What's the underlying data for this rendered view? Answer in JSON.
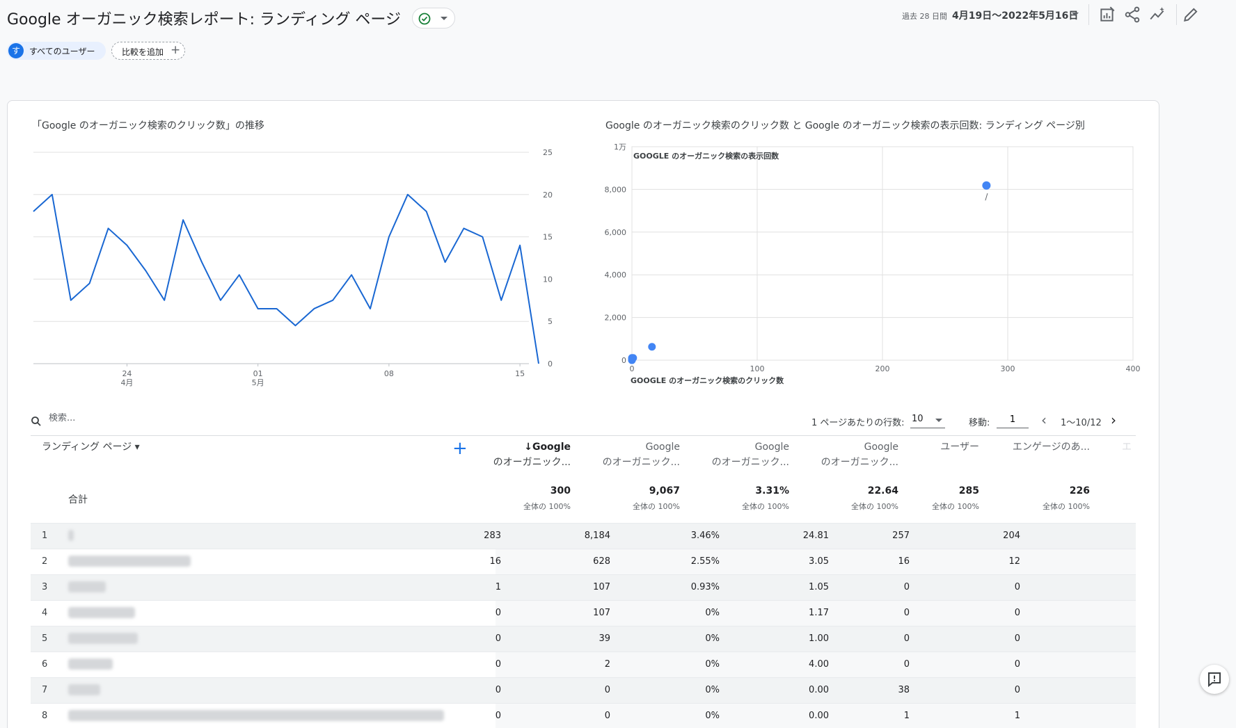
{
  "header": {
    "title": "Google オーガニック検索レポート: ランディング ページ",
    "date_label": "過去 28 日間",
    "date_range": "4月19日〜2022年5月16日"
  },
  "filters": {
    "user_avatar": "す",
    "user_chip": "すべてのユーザー",
    "add_comparison": "比較を追加"
  },
  "line_chart_title": "「Google のオーガニック検索のクリック数」の推移",
  "scatter_chart_title": "Google のオーガニック検索のクリック数 と Google のオーガニック検索の表示回数: ランディング ページ別",
  "chart_data": [
    {
      "type": "line",
      "title": "「Google のオーガニック検索のクリック数」の推移",
      "x": [
        "4/19",
        "4/20",
        "4/21",
        "4/22",
        "4/23",
        "4/24",
        "4/25",
        "4/26",
        "4/27",
        "4/28",
        "4/29",
        "4/30",
        "5/01",
        "5/02",
        "5/03",
        "5/04",
        "5/05",
        "5/06",
        "5/07",
        "5/08",
        "5/09",
        "5/10",
        "5/11",
        "5/12",
        "5/13",
        "5/14",
        "5/15",
        "5/16"
      ],
      "series": [
        {
          "values": [
            18,
            20,
            7.5,
            9.5,
            16,
            14,
            11,
            7.5,
            17,
            12,
            7.5,
            10.5,
            6.5,
            6.5,
            4.5,
            6.5,
            7.5,
            10.5,
            6.5,
            15,
            20,
            18,
            12,
            16,
            15,
            7.5,
            14,
            0
          ],
          "color": "#1967d2"
        }
      ],
      "x_tick_labels": [
        {
          "day": "24",
          "month": "4月",
          "x_index": 5
        },
        {
          "day": "01",
          "month": "5月",
          "x_index": 12
        },
        {
          "day": "08",
          "month": "",
          "x_index": 19
        },
        {
          "day": "15",
          "month": "",
          "x_index": 26
        }
      ],
      "y_ticks": [
        "0",
        "5",
        "10",
        "15",
        "20",
        "25"
      ],
      "ylim": [
        0,
        25
      ],
      "grid": true
    },
    {
      "type": "scatter",
      "title": "Google のオーガニック検索のクリック数 と Google のオーガニック検索の表示回数: ランディング ページ別",
      "xlabel": "GOOGLE のオーガニック検索のクリック数",
      "ylabel": "GOOGLE のオーガニック検索の表示回数",
      "xlim": [
        0,
        400
      ],
      "ylim": [
        0,
        10000
      ],
      "x_ticks": [
        "0",
        "100",
        "200",
        "300",
        "400"
      ],
      "y_ticks": [
        "0",
        "2,000",
        "4,000",
        "6,000",
        "8,000",
        "1万"
      ],
      "points": [
        {
          "x": 283,
          "y": 8184,
          "label": "/"
        },
        {
          "x": 16,
          "y": 628,
          "label": ""
        },
        {
          "x": 1,
          "y": 107,
          "label": ""
        },
        {
          "x": 0,
          "y": 107,
          "label": ""
        },
        {
          "x": 0,
          "y": 39,
          "label": ""
        },
        {
          "x": 0,
          "y": 2,
          "label": ""
        },
        {
          "x": 0,
          "y": 0,
          "label": ""
        }
      ],
      "color": "#4285f4",
      "grid": true
    }
  ],
  "table_controls": {
    "search_placeholder": "検索...",
    "rows_label": "1 ページあたりの行数:",
    "rows_value": "10",
    "goto_label": "移動:",
    "goto_value": "1",
    "pager_text": "1〜10/12"
  },
  "table": {
    "dimension_header": "ランディング ページ",
    "columns": [
      {
        "line1": "↓Google",
        "line2": "のオーガニック..."
      },
      {
        "line1": "Google",
        "line2": "のオーガニック..."
      },
      {
        "line1": "Google",
        "line2": "のオーガニック..."
      },
      {
        "line1": "Google",
        "line2": "のオーガニック..."
      },
      {
        "line1": "ユーザー",
        "line2": ""
      },
      {
        "line1": "エンゲージのあ...",
        "line2": ""
      },
      {
        "line1": "エ",
        "line2": ""
      }
    ],
    "totals": {
      "label": "合計",
      "values": [
        "300",
        "9,067",
        "3.31%",
        "22.64",
        "285",
        "226"
      ],
      "pcts": [
        "全体の 100%",
        "全体の 100%",
        "全体の 100%",
        "全体の 100%",
        "全体の 100%",
        "全体の 100%"
      ]
    },
    "rows": [
      {
        "idx": "1",
        "cells": [
          "283",
          "8,184",
          "3.46%",
          "24.81",
          "257",
          "204"
        ]
      },
      {
        "idx": "2",
        "cells": [
          "16",
          "628",
          "2.55%",
          "3.05",
          "16",
          "12"
        ]
      },
      {
        "idx": "3",
        "cells": [
          "1",
          "107",
          "0.93%",
          "1.05",
          "0",
          "0"
        ]
      },
      {
        "idx": "4",
        "cells": [
          "0",
          "107",
          "0%",
          "1.17",
          "0",
          "0"
        ]
      },
      {
        "idx": "5",
        "cells": [
          "0",
          "39",
          "0%",
          "1.00",
          "0",
          "0"
        ]
      },
      {
        "idx": "6",
        "cells": [
          "0",
          "2",
          "0%",
          "4.00",
          "0",
          "0"
        ]
      },
      {
        "idx": "7",
        "cells": [
          "0",
          "0",
          "0%",
          "0.00",
          "38",
          "0"
        ]
      },
      {
        "idx": "8",
        "cells": [
          "0",
          "0",
          "0%",
          "0.00",
          "1",
          "1"
        ]
      }
    ]
  }
}
